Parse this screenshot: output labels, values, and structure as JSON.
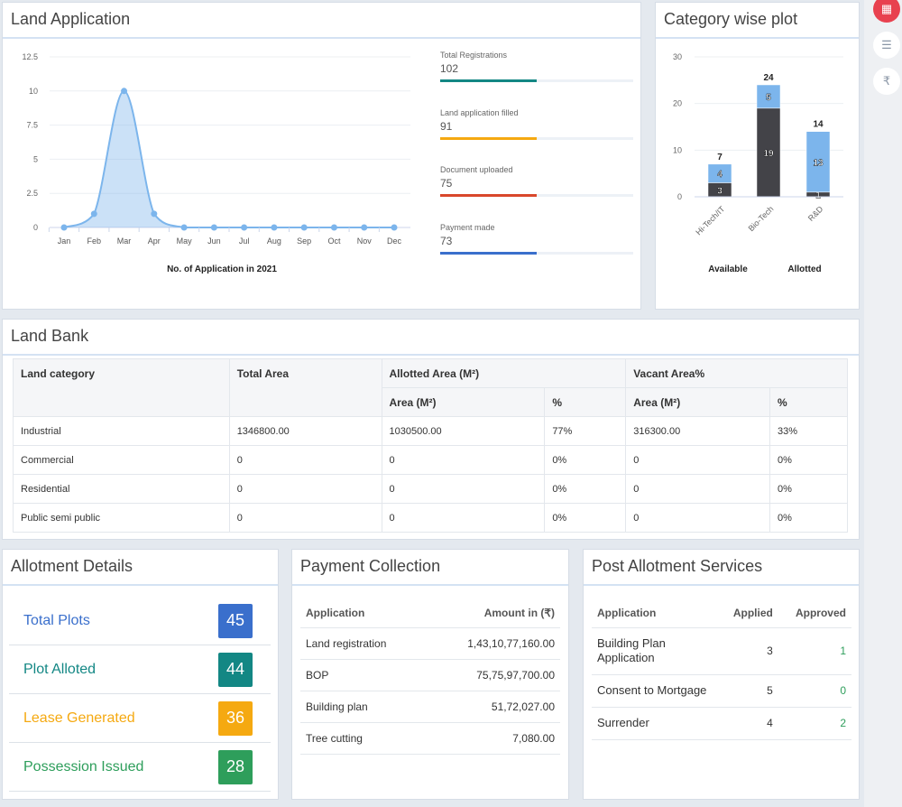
{
  "land_application": {
    "title": "Land Application",
    "stats": [
      {
        "label": "Total Registrations",
        "value": "102",
        "color": "#138784",
        "progress": 50
      },
      {
        "label": "Land application filled",
        "value": "91",
        "color": "#f5a911",
        "progress": 50
      },
      {
        "label": "Document uploaded",
        "value": "75",
        "color": "#d9472b",
        "progress": 50
      },
      {
        "label": "Payment made",
        "value": "73",
        "color": "#3a6fcc",
        "progress": 50
      }
    ]
  },
  "category_plot": {
    "title": "Category wise plot"
  },
  "chart_data": [
    {
      "type": "area",
      "title": "No. of Application in 2021",
      "categories": [
        "Jan",
        "Feb",
        "Mar",
        "Apr",
        "May",
        "Jun",
        "Jul",
        "Aug",
        "Sep",
        "Oct",
        "Nov",
        "Dec"
      ],
      "values": [
        0,
        1,
        10,
        1,
        0,
        0,
        0,
        0,
        0,
        0,
        0,
        0
      ],
      "yticks": [
        "0",
        "2.5",
        "5",
        "7.5",
        "10",
        "12.5"
      ],
      "ylim": [
        0,
        12.5
      ],
      "color": "#7cb5ec",
      "grid": true,
      "smooth": true
    },
    {
      "type": "bar",
      "stacked": true,
      "categories": [
        "Hi-Tech/IT",
        "Bio-Tech",
        "R&D"
      ],
      "series": [
        {
          "name": "Allotted",
          "values": [
            3,
            19,
            1
          ],
          "color": "#434348"
        },
        {
          "name": "Available",
          "values": [
            4,
            5,
            13
          ],
          "color": "#7cb5ec"
        }
      ],
      "totals": [
        "7",
        "24",
        "14"
      ],
      "yticks": [
        "0",
        "10",
        "20",
        "30"
      ],
      "ylim": [
        0,
        30
      ],
      "legend": [
        "Available",
        "Allotted"
      ],
      "legend_placement": "bottom",
      "grid": true
    }
  ],
  "land_bank": {
    "title": "Land Bank",
    "headers": {
      "category": "Land category",
      "total": "Total Area",
      "allotted": "Allotted Area (M²)",
      "vacant": "Vacant Area%",
      "area": "Area (M²)",
      "pct": "%"
    },
    "rows": [
      [
        "Industrial",
        "1346800.00",
        "1030500.00",
        "77%",
        "316300.00",
        "33%"
      ],
      [
        "Commercial",
        "0",
        "0",
        "0%",
        "0",
        "0%"
      ],
      [
        "Residential",
        "0",
        "0",
        "0%",
        "0",
        "0%"
      ],
      [
        "Public semi public",
        "0",
        "0",
        "0%",
        "0",
        "0%"
      ]
    ]
  },
  "allotment": {
    "title": "Allotment Details",
    "items": [
      {
        "label": "Total Plots",
        "value": "45",
        "color": "#3a6fcc"
      },
      {
        "label": "Plot Alloted",
        "value": "44",
        "color": "#138784"
      },
      {
        "label": "Lease Generated",
        "value": "36",
        "color": "#f5a911"
      },
      {
        "label": "Possession Issued",
        "value": "28",
        "color": "#2e9e5b"
      }
    ]
  },
  "payment": {
    "title": "Payment Collection",
    "headers": [
      "Application",
      "Amount in (₹)"
    ],
    "rows": [
      [
        "Land registration",
        "1,43,10,77,160.00"
      ],
      [
        "BOP",
        "75,75,97,700.00"
      ],
      [
        "Building plan",
        "51,72,027.00"
      ],
      [
        "Tree cutting",
        "7,080.00"
      ]
    ]
  },
  "post_allotment": {
    "title": "Post Allotment Services",
    "headers": [
      "Application",
      "Applied",
      "Approved"
    ],
    "rows": [
      [
        "Building Plan Application",
        "3",
        "1"
      ],
      [
        "Consent to Mortgage",
        "5",
        "0"
      ],
      [
        "Surrender",
        "4",
        "2"
      ]
    ]
  },
  "sidebar": {
    "icons": [
      "calendar-icon",
      "list-icon",
      "rupee-icon"
    ],
    "rupee": "₹"
  }
}
